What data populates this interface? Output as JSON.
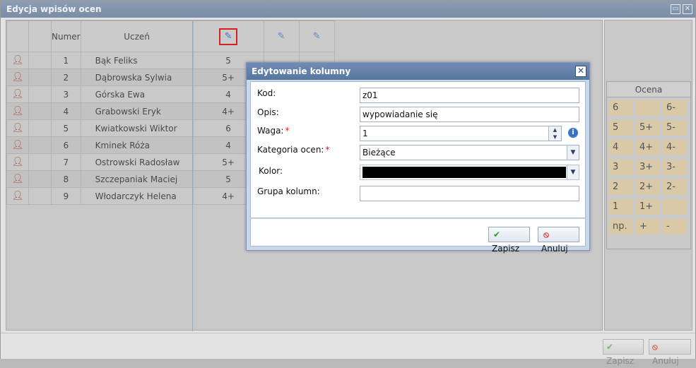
{
  "window": {
    "title": "Edycja wpisów ocen"
  },
  "grid": {
    "headers": {
      "number": "Numer",
      "student": "Uczeń"
    },
    "rows": [
      {
        "number": "1",
        "name": "Bąk Feliks",
        "grade": "5"
      },
      {
        "number": "2",
        "name": "Dąbrowska Sylwia",
        "grade": "5+"
      },
      {
        "number": "3",
        "name": "Górska Ewa",
        "grade": "4"
      },
      {
        "number": "4",
        "name": "Grabowski Eryk",
        "grade": "4+"
      },
      {
        "number": "5",
        "name": "Kwiatkowski Wiktor",
        "grade": "6"
      },
      {
        "number": "6",
        "name": "Kminek Róża",
        "grade": "4"
      },
      {
        "number": "7",
        "name": "Ostrowski Radosław",
        "grade": "5+"
      },
      {
        "number": "8",
        "name": "Szczepaniak Maciej",
        "grade": "5"
      },
      {
        "number": "9",
        "name": "Włodarczyk Helena",
        "grade": "4+"
      }
    ]
  },
  "ocena": {
    "title": "Ocena",
    "cells": [
      "6",
      "",
      "6-",
      "5",
      "5+",
      "5-",
      "4",
      "4+",
      "4-",
      "3",
      "3+",
      "3-",
      "2",
      "2+",
      "2-",
      "1",
      "1+",
      "",
      "np.",
      "+",
      "-"
    ]
  },
  "footer": {
    "save_label": "Zapisz",
    "cancel_label": "Anuluj"
  },
  "modal": {
    "title": "Edytowanie kolumny",
    "labels": {
      "kod": "Kod:",
      "opis": "Opis:",
      "waga": "Waga:",
      "kategoria": "Kategoria ocen:",
      "kolor": "Kolor:",
      "grupa": "Grupa kolumn:"
    },
    "values": {
      "kod": "z01",
      "opis": "wypowiadanie się",
      "waga": "1",
      "kategoria": "Bieżące",
      "grupa": ""
    },
    "required_mark": "*",
    "color_value": "#000000",
    "save_label": "Zapisz",
    "cancel_label": "Anuluj"
  }
}
